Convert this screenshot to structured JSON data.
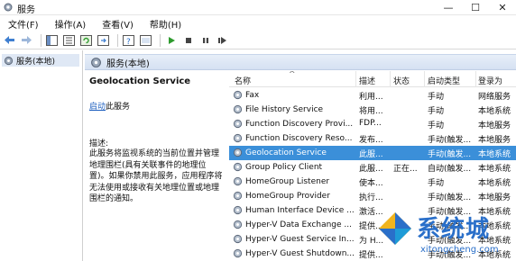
{
  "window": {
    "title": "服务",
    "minimize_glyph": "—",
    "maximize_glyph": "☐",
    "close_glyph": "✕"
  },
  "menu": {
    "items": [
      {
        "label": "文件(F)"
      },
      {
        "label": "操作(A)"
      },
      {
        "label": "查看(V)"
      },
      {
        "label": "帮助(H)"
      }
    ]
  },
  "toolbar": {
    "icons": [
      "back-icon",
      "forward-icon",
      "show-hide-tree-icon",
      "properties-icon",
      "refresh-icon",
      "export-icon",
      "help-icon",
      "console-icon",
      "start-icon",
      "stop-icon",
      "pause-icon",
      "restart-icon"
    ]
  },
  "tree": {
    "item_label": "服务(本地)"
  },
  "panel": {
    "header_label": "服务(本地)"
  },
  "details": {
    "service_name": "Geolocation Service",
    "start_link": "启动",
    "start_suffix": "此服务",
    "description_label": "描述:",
    "description_text": "此服务将监视系统的当前位置并管理地理围栏(具有关联事件的地理位置)。如果你禁用此服务，应用程序将无法使用或接收有关地理位置或地理围栏的通知。"
  },
  "columns": {
    "name": "名称",
    "description": "描述",
    "status": "状态",
    "startup_type": "启动类型",
    "log_on_as": "登录为"
  },
  "services": [
    {
      "name": "Fax",
      "description": "利用...",
      "status": "",
      "startup": "手动",
      "logon": "网络服务",
      "selected": false
    },
    {
      "name": "File History Service",
      "description": "将用...",
      "status": "",
      "startup": "手动",
      "logon": "本地系统",
      "selected": false
    },
    {
      "name": "Function Discovery Provi...",
      "description": "FDP...",
      "status": "",
      "startup": "手动",
      "logon": "本地服务",
      "selected": false
    },
    {
      "name": "Function Discovery Reso...",
      "description": "发布...",
      "status": "",
      "startup": "手动(触发...",
      "logon": "本地服务",
      "selected": false
    },
    {
      "name": "Geolocation Service",
      "description": "此服...",
      "status": "",
      "startup": "手动(触发...",
      "logon": "本地系统",
      "selected": true
    },
    {
      "name": "Group Policy Client",
      "description": "此服...",
      "status": "正在...",
      "startup": "自动(触发...",
      "logon": "本地系统",
      "selected": false
    },
    {
      "name": "HomeGroup Listener",
      "description": "使本...",
      "status": "",
      "startup": "手动",
      "logon": "本地系统",
      "selected": false
    },
    {
      "name": "HomeGroup Provider",
      "description": "执行...",
      "status": "",
      "startup": "手动(触发...",
      "logon": "本地服务",
      "selected": false
    },
    {
      "name": "Human Interface Device ...",
      "description": "激活...",
      "status": "",
      "startup": "手动(触发...",
      "logon": "本地系统",
      "selected": false
    },
    {
      "name": "Hyper-V Data Exchange ...",
      "description": "提供...",
      "status": "",
      "startup": "手动(触发...",
      "logon": "本地系统",
      "selected": false
    },
    {
      "name": "Hyper-V Guest Service In...",
      "description": "为 H...",
      "status": "",
      "startup": "手动(触发...",
      "logon": "本地系统",
      "selected": false
    },
    {
      "name": "Hyper-V Guest Shutdown...",
      "description": "提供...",
      "status": "",
      "startup": "手动(触发...",
      "logon": "本地系统",
      "selected": false
    }
  ],
  "watermark": {
    "brand": "系统城",
    "url": "xitongcheng.com"
  },
  "colors": {
    "selection": "#3b8fd9",
    "header_gradient_top": "#e7eef8",
    "link": "#1d5fbf",
    "watermark": "#2a6fc9"
  }
}
